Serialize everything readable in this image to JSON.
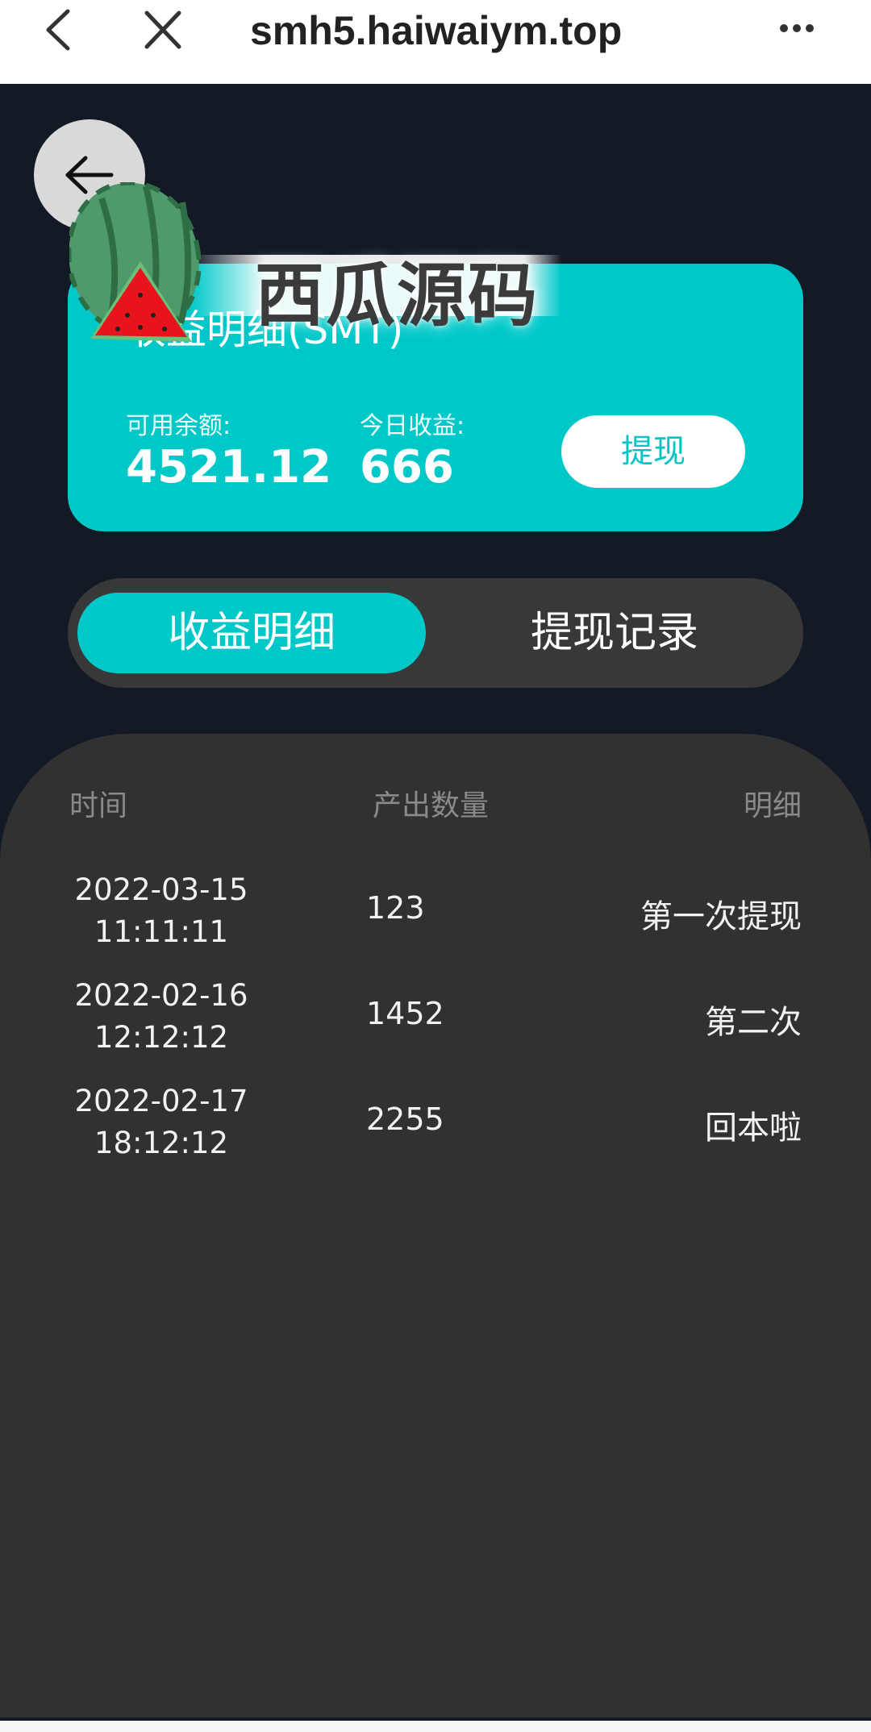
{
  "browser": {
    "url": "smh5.haiwaiym.top",
    "back_icon": "chevron-left-icon",
    "close_icon": "close-icon",
    "more_icon": "more-dots-icon"
  },
  "page": {
    "back_icon": "arrow-left-icon"
  },
  "card": {
    "title": "收益明细(SMT)",
    "available_label": "可用余额:",
    "available_value": "4521.12",
    "today_label": "今日收益:",
    "today_value": "666",
    "withdraw_label": "提现"
  },
  "watermark": {
    "text": "西瓜源码"
  },
  "tabs": [
    {
      "label": "收益明细",
      "active": true
    },
    {
      "label": "提现记录",
      "active": false
    }
  ],
  "table": {
    "headers": [
      "时间",
      "产出数量",
      "明细"
    ],
    "rows": [
      {
        "date": "2022-03-15",
        "time": "11:11:11",
        "amount": "123",
        "detail": "第一次提现"
      },
      {
        "date": "2022-02-16",
        "time": "12:12:12",
        "amount": "1452",
        "detail": "第二次"
      },
      {
        "date": "2022-02-17",
        "time": "18:12:12",
        "amount": "2255",
        "detail": "回本啦"
      }
    ]
  },
  "colors": {
    "accent": "#00c8c9",
    "background": "#131a26",
    "panel": "#313131",
    "tab_track": "#383838"
  }
}
